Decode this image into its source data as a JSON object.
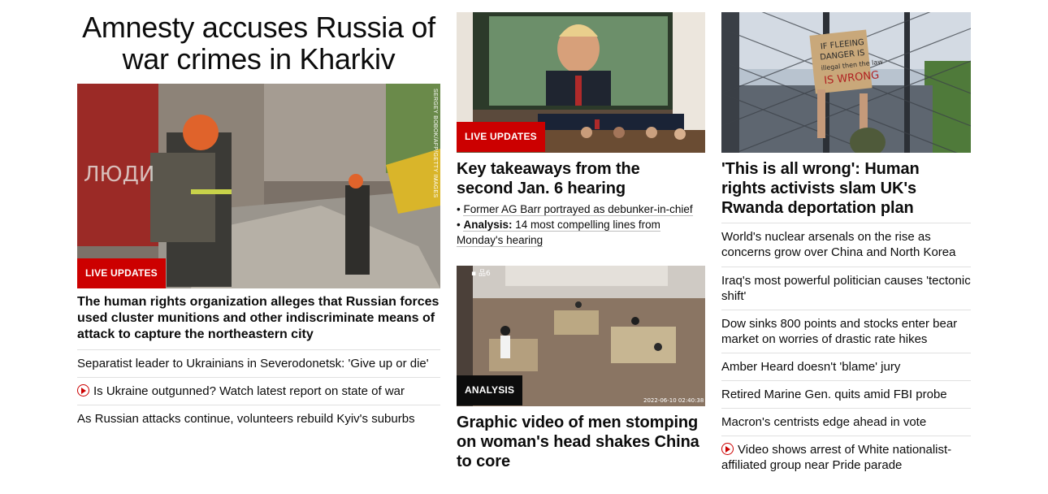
{
  "lead": {
    "headline": "Amnesty accuses Russia of war crimes in Kharkiv",
    "badge": "LIVE UPDATES",
    "photo_credit": "SERGEY BOBOK/AFP/GETTY IMAGES",
    "description": "The human rights organization alleges that Russian forces used cluster munitions and other indiscriminate means of attack to capture the northeastern city",
    "related": [
      {
        "text": "Separatist leader to Ukrainians in Severodonetsk: 'Give up or die'",
        "video": false
      },
      {
        "text": "Is Ukraine outgunned? Watch latest report on state of war",
        "video": true
      },
      {
        "text": "As Russian attacks continue, volunteers rebuild Kyiv's suburbs",
        "video": false
      }
    ]
  },
  "card_jan6": {
    "badge": "LIVE UPDATES",
    "title": "Key takeaways from the second Jan. 6 hearing",
    "bullet1": "Former AG Barr portrayed as debunker-in-chief",
    "bullet2_label": "Analysis:",
    "bullet2_text": "14 most compelling lines from Monday's hearing"
  },
  "card_china": {
    "badge": "ANALYSIS",
    "title": "Graphic video of men stomping on woman's head shakes China to core"
  },
  "card_uk": {
    "title": "'This is all wrong': Human rights activists slam UK's Rwanda deportation plan",
    "sign_text": "IF FLEEING DANGER IS ILLEGAL THEN THE LAW IS WRONG"
  },
  "headlines": [
    {
      "text": "World's nuclear arsenals on the rise as concerns grow over China and North Korea",
      "video": false
    },
    {
      "text": "Iraq's most powerful politician causes 'tectonic shift'",
      "video": false
    },
    {
      "text": "Dow sinks 800 points and stocks enter bear market on worries of drastic rate hikes",
      "video": false
    },
    {
      "text": "Amber Heard doesn't 'blame' jury",
      "video": false
    },
    {
      "text": "Retired Marine Gen. quits amid FBI probe",
      "video": false
    },
    {
      "text": "Macron's centrists edge ahead in vote",
      "video": false
    },
    {
      "text": "Video shows arrest of White nationalist-affiliated group near Pride parade",
      "video": true
    }
  ],
  "colors": {
    "accent": "#cc0000",
    "text": "#0c0c0c",
    "divider": "#e0e0e0"
  }
}
